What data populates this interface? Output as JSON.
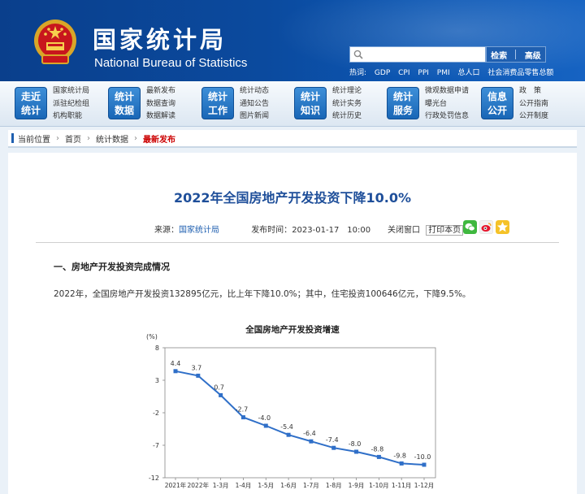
{
  "header": {
    "site_cn": "国家统计局",
    "site_en": "National Bureau of Statistics",
    "search_button": "检索",
    "advanced_button": "高级",
    "hotwords": [
      "热词:",
      "GDP",
      "CPI",
      "PPI",
      "PMI",
      "总人口",
      "社会消费品零售总额"
    ]
  },
  "nav": [
    {
      "badge_top": "走近",
      "badge_bottom": "统计",
      "links": [
        "国家统计局",
        "派驻纪检组",
        "机构职能"
      ]
    },
    {
      "badge_top": "统计",
      "badge_bottom": "数据",
      "links": [
        "最新发布",
        "数据查询",
        "数据解读"
      ]
    },
    {
      "badge_top": "统计",
      "badge_bottom": "工作",
      "links": [
        "统计动态",
        "通知公告",
        "图片新闻"
      ]
    },
    {
      "badge_top": "统计",
      "badge_bottom": "知识",
      "links": [
        "统计理论",
        "统计实务",
        "统计历史"
      ]
    },
    {
      "badge_top": "统计",
      "badge_bottom": "服务",
      "links": [
        "微观数据申请",
        "曝光台",
        "行政处罚信息"
      ]
    },
    {
      "badge_top": "信息",
      "badge_bottom": "公开",
      "links": [
        "政　策",
        "公开指南",
        "公开制度"
      ]
    }
  ],
  "breadcrumb": {
    "label": "当前位置",
    "items": [
      "首页",
      "统计数据",
      "最新发布"
    ]
  },
  "article": {
    "title": "2022年全国房地产开发投资下降10.0%",
    "source_label": "来源：",
    "source": "国家统计局",
    "published_label": "发布时间：",
    "published": "2023-01-17　10:00",
    "close_label": "关闭窗口",
    "print_label": "打印本页",
    "section1": "一、房地产开发投资完成情况",
    "para1": "2022年，全国房地产开发投资132895亿元，比上年下降10.0%；其中，住宅投资100646亿元，下降9.5%。"
  },
  "colors": {
    "accent": "#1f5fb0",
    "line": "#2f6fc8",
    "title": "#1f4f9a"
  },
  "chart_data": {
    "type": "line",
    "title": "全国房地产开发投资增速",
    "ylabel": "(%)",
    "ylim": [
      -12,
      8
    ],
    "yticks": [
      8,
      3,
      -2,
      -7,
      -12
    ],
    "categories": [
      "2021年1-12月",
      "2022年1-2月",
      "1-3月",
      "1-4月",
      "1-5月",
      "1-6月",
      "1-7月",
      "1-8月",
      "1-9月",
      "1-10月",
      "1-11月",
      "1-12月"
    ],
    "x_tick_labels": [
      "2021年",
      "2022年",
      "1-3月",
      "1-4月",
      "1-5月",
      "1-6月",
      "1-7月",
      "1-8月",
      "1-9月",
      "1-10月",
      "1-11月",
      "1-12月"
    ],
    "values": [
      4.4,
      3.7,
      0.7,
      -2.7,
      -4.0,
      -5.4,
      -6.4,
      -7.4,
      -8.0,
      -8.8,
      -9.8,
      -10.0
    ],
    "data_labels": [
      "4.4",
      "3.7",
      "0.7",
      "-2.7",
      "-4.0",
      "-5.4",
      "-6.4",
      "-7.4",
      "-8.0",
      "-8.8",
      "-9.8",
      "-10.0"
    ]
  }
}
